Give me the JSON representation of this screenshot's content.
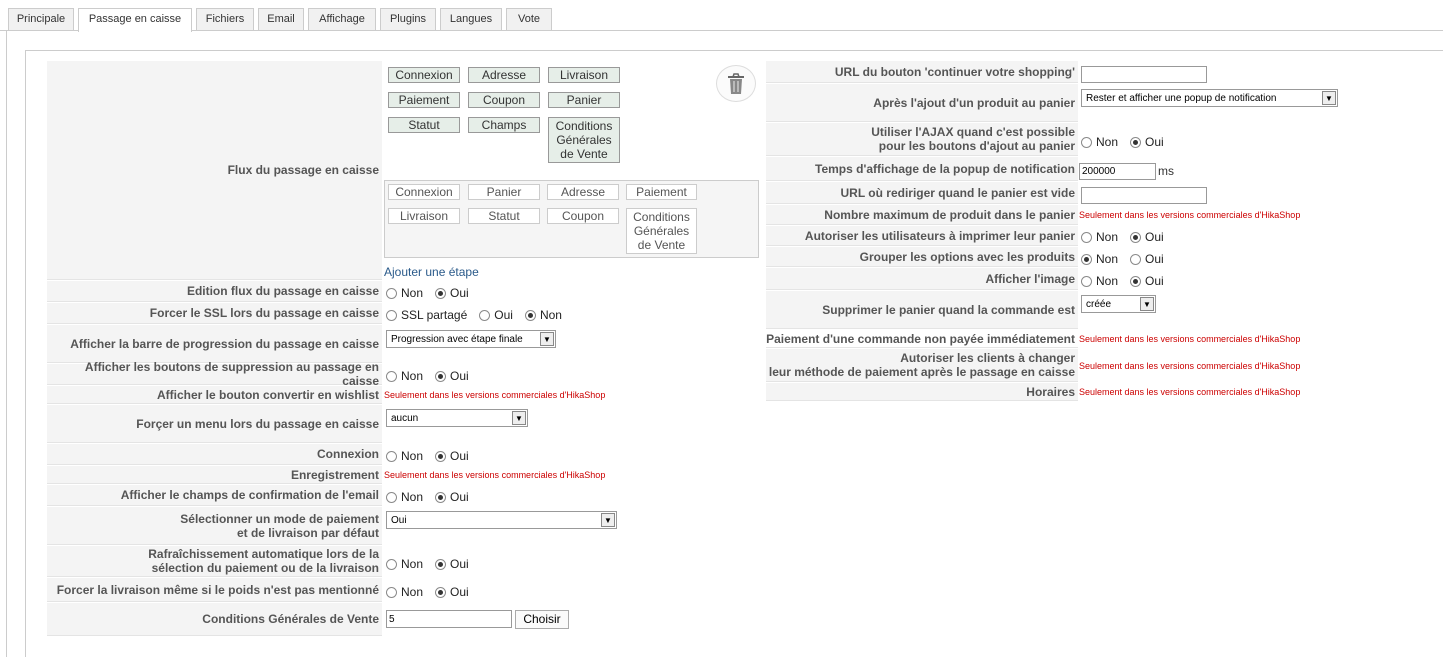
{
  "tabs": [
    "Principale",
    "Passage en caisse",
    "Fichiers",
    "Email",
    "Affichage",
    "Plugins",
    "Langues",
    "Vote"
  ],
  "active_tab": "Passage en caisse",
  "icons": {
    "trash": "trash-icon"
  },
  "commercial_note": "Seulement dans les versions commerciales d'HikaShop",
  "left": {
    "flow_label": "Flux du passage en caisse",
    "available_steps": [
      "Connexion",
      "Adresse",
      "Livraison",
      "Paiement",
      "Coupon",
      "Panier",
      "Statut",
      "Champs",
      "Conditions Générales de Vente"
    ],
    "current_steps": [
      "Connexion",
      "Panier",
      "Adresse",
      "Paiement",
      "Livraison",
      "Statut",
      "Coupon",
      "Conditions Générales de Vente"
    ],
    "add_step": "Ajouter une étape",
    "edit_flow_label": "Edition flux du passage en caisse",
    "force_ssl_label": "Forcer le SSL lors du passage en caisse",
    "ssl_options": [
      "SSL partagé",
      "Oui",
      "Non"
    ],
    "progress_label": "Afficher la barre de progression du passage en caisse",
    "progress_value": "Progression avec étape finale",
    "delete_buttons_label": "Afficher les boutons de suppression au passage en caisse",
    "wishlist_label": "Afficher le bouton convertir en wishlist",
    "force_menu_label": "Forçer un menu lors du passage en caisse",
    "force_menu_value": "aucun",
    "login_label": "Connexion",
    "register_label": "Enregistrement",
    "confirm_email_label": "Afficher le champs de confirmation de l'email",
    "default_payment_label": [
      "Sélectionner un mode de paiement",
      "et de livraison par défaut"
    ],
    "default_payment_value": "Oui",
    "auto_refresh_label": [
      "Rafraîchissement automatique lors de la",
      "sélection du paiement ou de la livraison"
    ],
    "force_shipping_label": "Forcer la livraison même si le poids n'est pas mentionné",
    "terms_label": "Conditions Générales de Vente",
    "terms_value": "5",
    "choose_button": "Choisir",
    "no": "Non",
    "yes": "Oui"
  },
  "right": {
    "continue_url_label": "URL du bouton 'continuer votre shopping'",
    "after_add_label": "Après l'ajout d'un produit au panier",
    "after_add_value": "Rester et afficher une popup de notification",
    "ajax_label": [
      "Utiliser l'AJAX quand c'est possible",
      "pour les boutons d'ajout au panier"
    ],
    "popup_time_label": "Temps d'affichage de la popup de notification",
    "popup_time_value": "200000",
    "popup_time_unit": "ms",
    "empty_cart_url_label": "URL où rediriger quand le panier est vide",
    "max_products_label": "Nombre maximum de produit dans le panier",
    "print_cart_label": "Autoriser les utilisateurs à imprimer leur panier",
    "group_options_label": "Grouper les options avec les produits",
    "show_image_label": "Afficher l'image",
    "delete_cart_label": "Supprimer le panier quand la commande est",
    "delete_cart_value": "créée",
    "unpaid_label": "Paiement d'une commande non payée immédiatement",
    "change_payment_label": [
      "Autoriser les clients à changer",
      "leur méthode de paiement après le passage en caisse"
    ],
    "hours_label": "Horaires"
  }
}
